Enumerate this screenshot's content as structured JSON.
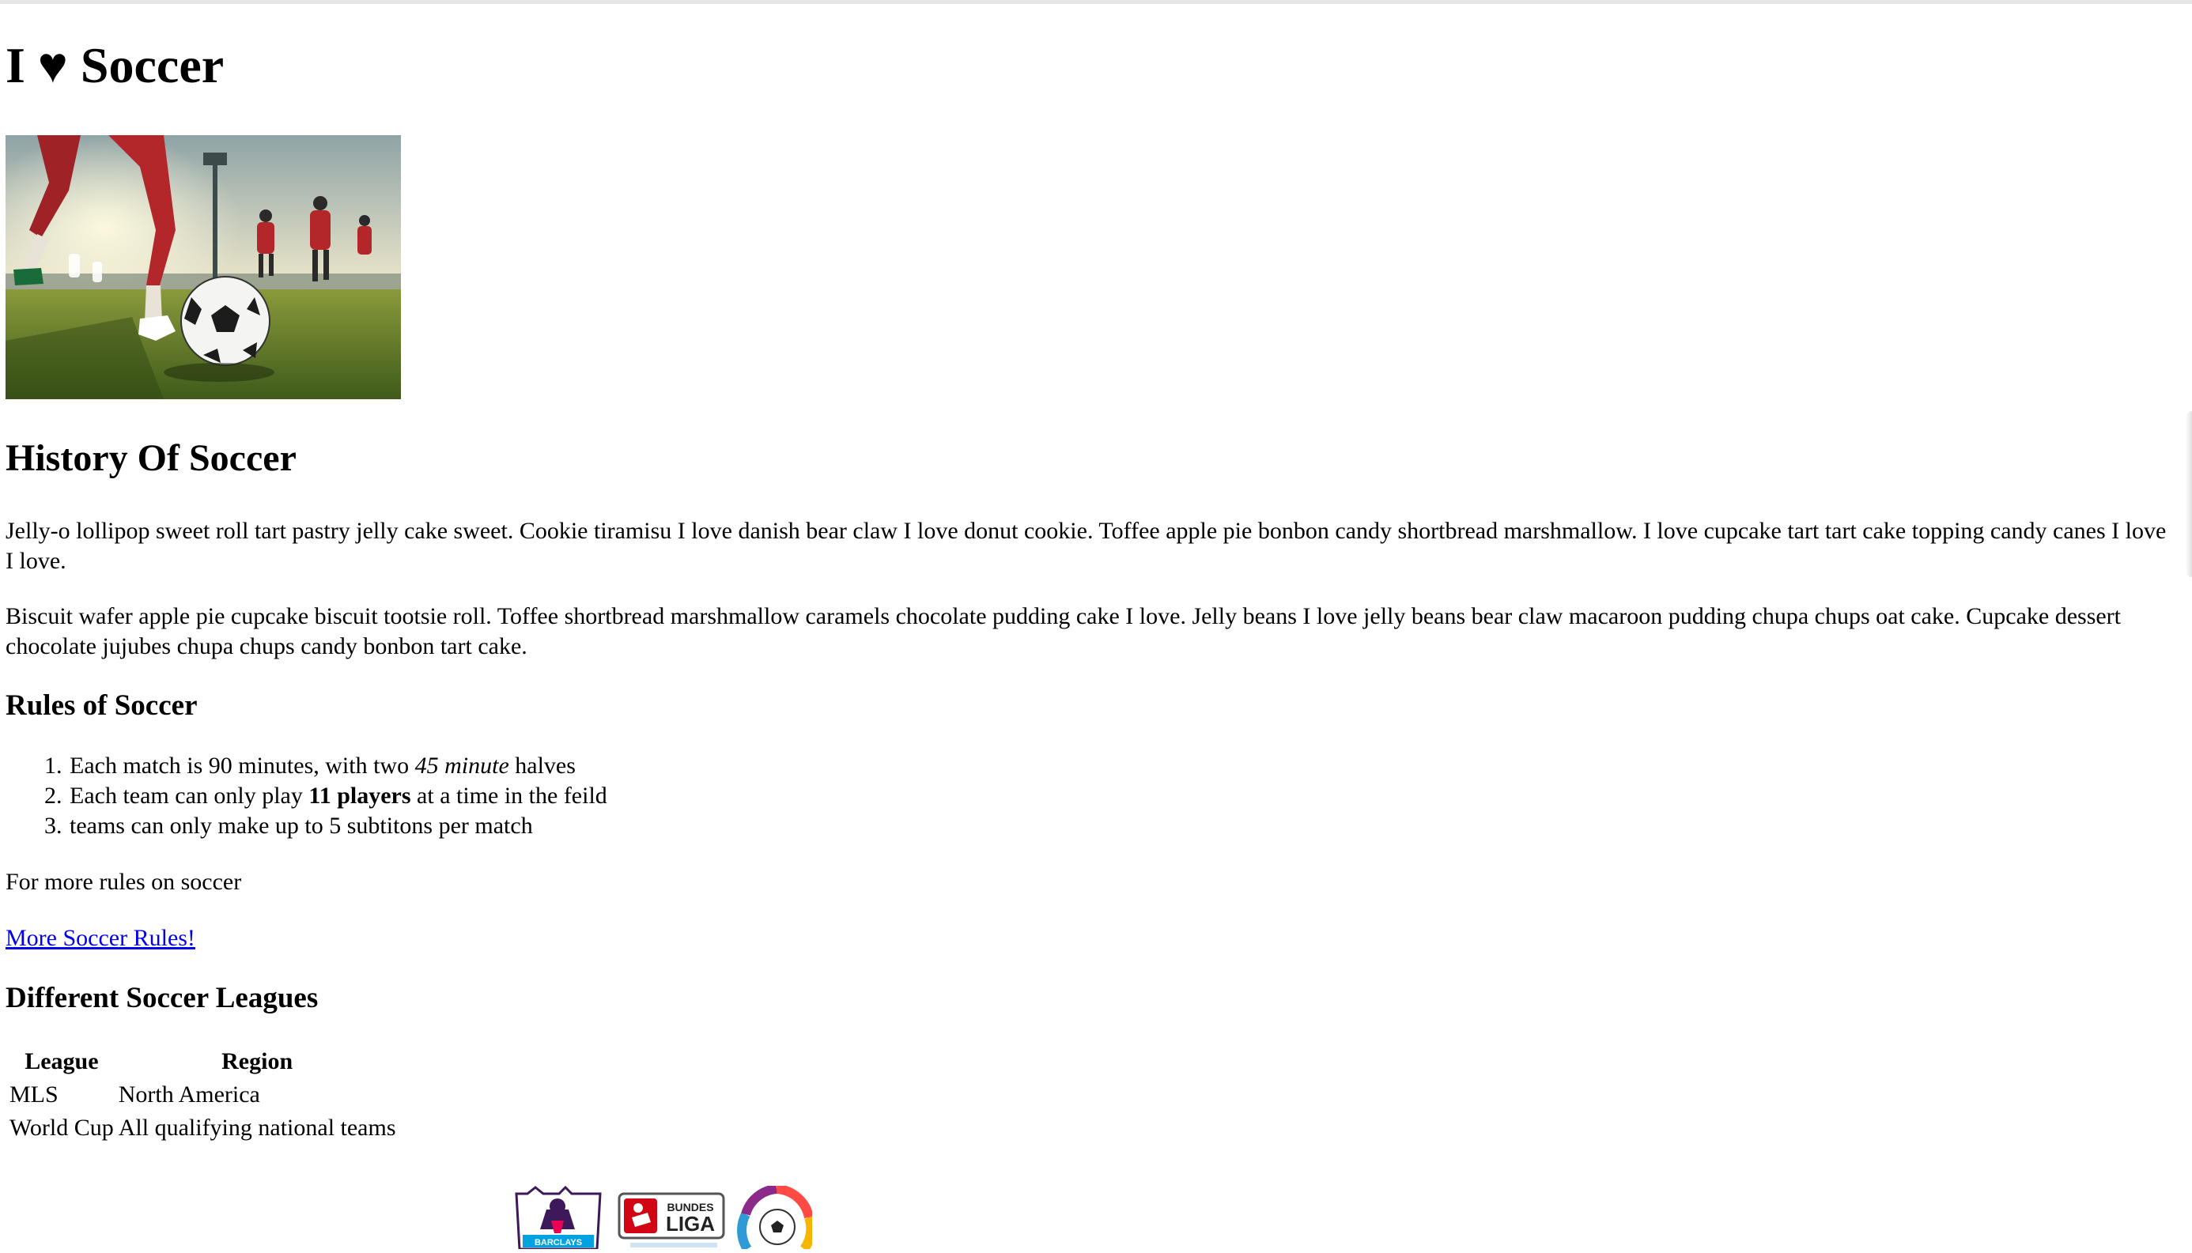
{
  "page": {
    "title": "I ♥ Soccer",
    "history_heading": "History Of Soccer",
    "history_paragraphs": [
      "Jelly-o lollipop sweet roll tart pastry jelly cake sweet. Cookie tiramisu I love danish bear claw I love donut cookie. Toffee apple pie bonbon candy shortbread marshmallow. I love cupcake tart tart cake topping candy canes I love I love.",
      "Biscuit wafer apple pie cupcake biscuit tootsie roll. Toffee shortbread marshmallow caramels chocolate pudding cake I love. Jelly beans I love jelly beans bear claw macaroon pudding chupa chups oat cake. Cupcake dessert chocolate jujubes chupa chups candy bonbon tart cake."
    ],
    "rules_heading": "Rules of Soccer",
    "rules": [
      {
        "before": "Each match is 90 minutes, with two ",
        "emphasis": "45 minute",
        "after": " halves"
      },
      {
        "before": "Each team can only play ",
        "strong": "11 players",
        "after": " at a time in the feild"
      },
      {
        "text": "teams can only make up to 5 subtitons per match"
      }
    ],
    "more_rules_text": "For more rules on soccer",
    "more_rules_link": "More Soccer Rules!",
    "leagues_heading": "Different Soccer Leagues",
    "leagues_table": {
      "headers": [
        "League",
        "Region"
      ],
      "rows": [
        [
          "MLS",
          "North America"
        ],
        [
          "World Cup",
          "All qualifying national teams"
        ]
      ]
    },
    "logos": {
      "premier_league_text": "BARCLAYS",
      "bundesliga_text_top": "BUNDES",
      "bundesliga_text_bottom": "LIGA"
    }
  },
  "colors": {
    "link": "#0000ee",
    "pitch_green": "#6f8a2c",
    "sky": "#cfd8c9",
    "jersey_red": "#b3262a"
  },
  "icons": {
    "hero_image": "soccer-player-kicking-ball-image",
    "logos": [
      "premier-league-logo",
      "bundesliga-logo",
      "laliga-logo"
    ]
  }
}
